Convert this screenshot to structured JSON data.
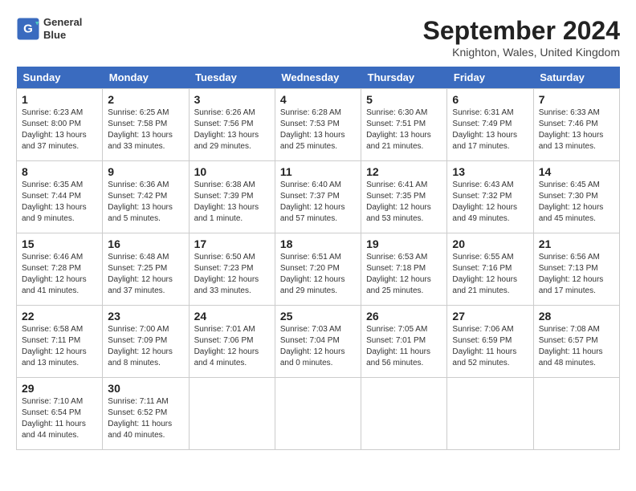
{
  "header": {
    "logo_line1": "General",
    "logo_line2": "Blue",
    "month_title": "September 2024",
    "location": "Knighton, Wales, United Kingdom"
  },
  "days_of_week": [
    "Sunday",
    "Monday",
    "Tuesday",
    "Wednesday",
    "Thursday",
    "Friday",
    "Saturday"
  ],
  "weeks": [
    [
      {
        "day": "1",
        "sunrise": "6:23 AM",
        "sunset": "8:00 PM",
        "daylight": "13 hours and 37 minutes."
      },
      {
        "day": "2",
        "sunrise": "6:25 AM",
        "sunset": "7:58 PM",
        "daylight": "13 hours and 33 minutes."
      },
      {
        "day": "3",
        "sunrise": "6:26 AM",
        "sunset": "7:56 PM",
        "daylight": "13 hours and 29 minutes."
      },
      {
        "day": "4",
        "sunrise": "6:28 AM",
        "sunset": "7:53 PM",
        "daylight": "13 hours and 25 minutes."
      },
      {
        "day": "5",
        "sunrise": "6:30 AM",
        "sunset": "7:51 PM",
        "daylight": "13 hours and 21 minutes."
      },
      {
        "day": "6",
        "sunrise": "6:31 AM",
        "sunset": "7:49 PM",
        "daylight": "13 hours and 17 minutes."
      },
      {
        "day": "7",
        "sunrise": "6:33 AM",
        "sunset": "7:46 PM",
        "daylight": "13 hours and 13 minutes."
      }
    ],
    [
      {
        "day": "8",
        "sunrise": "6:35 AM",
        "sunset": "7:44 PM",
        "daylight": "13 hours and 9 minutes."
      },
      {
        "day": "9",
        "sunrise": "6:36 AM",
        "sunset": "7:42 PM",
        "daylight": "13 hours and 5 minutes."
      },
      {
        "day": "10",
        "sunrise": "6:38 AM",
        "sunset": "7:39 PM",
        "daylight": "13 hours and 1 minute."
      },
      {
        "day": "11",
        "sunrise": "6:40 AM",
        "sunset": "7:37 PM",
        "daylight": "12 hours and 57 minutes."
      },
      {
        "day": "12",
        "sunrise": "6:41 AM",
        "sunset": "7:35 PM",
        "daylight": "12 hours and 53 minutes."
      },
      {
        "day": "13",
        "sunrise": "6:43 AM",
        "sunset": "7:32 PM",
        "daylight": "12 hours and 49 minutes."
      },
      {
        "day": "14",
        "sunrise": "6:45 AM",
        "sunset": "7:30 PM",
        "daylight": "12 hours and 45 minutes."
      }
    ],
    [
      {
        "day": "15",
        "sunrise": "6:46 AM",
        "sunset": "7:28 PM",
        "daylight": "12 hours and 41 minutes."
      },
      {
        "day": "16",
        "sunrise": "6:48 AM",
        "sunset": "7:25 PM",
        "daylight": "12 hours and 37 minutes."
      },
      {
        "day": "17",
        "sunrise": "6:50 AM",
        "sunset": "7:23 PM",
        "daylight": "12 hours and 33 minutes."
      },
      {
        "day": "18",
        "sunrise": "6:51 AM",
        "sunset": "7:20 PM",
        "daylight": "12 hours and 29 minutes."
      },
      {
        "day": "19",
        "sunrise": "6:53 AM",
        "sunset": "7:18 PM",
        "daylight": "12 hours and 25 minutes."
      },
      {
        "day": "20",
        "sunrise": "6:55 AM",
        "sunset": "7:16 PM",
        "daylight": "12 hours and 21 minutes."
      },
      {
        "day": "21",
        "sunrise": "6:56 AM",
        "sunset": "7:13 PM",
        "daylight": "12 hours and 17 minutes."
      }
    ],
    [
      {
        "day": "22",
        "sunrise": "6:58 AM",
        "sunset": "7:11 PM",
        "daylight": "12 hours and 13 minutes."
      },
      {
        "day": "23",
        "sunrise": "7:00 AM",
        "sunset": "7:09 PM",
        "daylight": "12 hours and 8 minutes."
      },
      {
        "day": "24",
        "sunrise": "7:01 AM",
        "sunset": "7:06 PM",
        "daylight": "12 hours and 4 minutes."
      },
      {
        "day": "25",
        "sunrise": "7:03 AM",
        "sunset": "7:04 PM",
        "daylight": "12 hours and 0 minutes."
      },
      {
        "day": "26",
        "sunrise": "7:05 AM",
        "sunset": "7:01 PM",
        "daylight": "11 hours and 56 minutes."
      },
      {
        "day": "27",
        "sunrise": "7:06 AM",
        "sunset": "6:59 PM",
        "daylight": "11 hours and 52 minutes."
      },
      {
        "day": "28",
        "sunrise": "7:08 AM",
        "sunset": "6:57 PM",
        "daylight": "11 hours and 48 minutes."
      }
    ],
    [
      {
        "day": "29",
        "sunrise": "7:10 AM",
        "sunset": "6:54 PM",
        "daylight": "11 hours and 44 minutes."
      },
      {
        "day": "30",
        "sunrise": "7:11 AM",
        "sunset": "6:52 PM",
        "daylight": "11 hours and 40 minutes."
      },
      null,
      null,
      null,
      null,
      null
    ]
  ]
}
